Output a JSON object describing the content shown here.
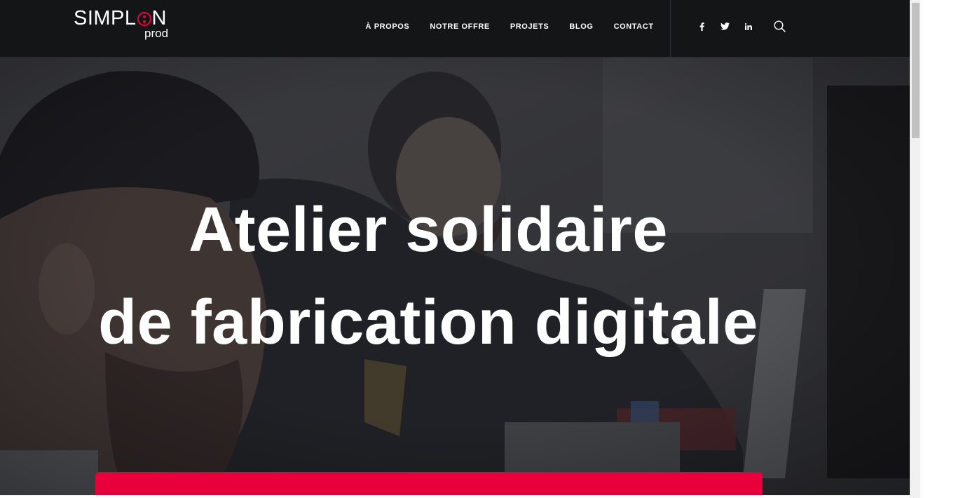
{
  "header": {
    "logo": {
      "main": "SIMPL",
      "ring_letter": "O",
      "main_end": "N",
      "sub": "prod"
    },
    "nav": [
      {
        "label": "À PROPOS"
      },
      {
        "label": "NOTRE OFFRE"
      },
      {
        "label": "PROJETS"
      },
      {
        "label": "BLOG"
      },
      {
        "label": "CONTACT"
      }
    ],
    "social": [
      {
        "icon": "facebook-icon"
      },
      {
        "icon": "twitter-icon"
      },
      {
        "icon": "linkedin-icon"
      }
    ],
    "search_icon": "search-icon"
  },
  "hero": {
    "title_line1": "Atelier solidaire",
    "title_line2": "de fabrication digitale"
  },
  "colors": {
    "header_bg": "#141517",
    "accent": "#e8003d",
    "hero_overlay": "#2b2c30"
  }
}
